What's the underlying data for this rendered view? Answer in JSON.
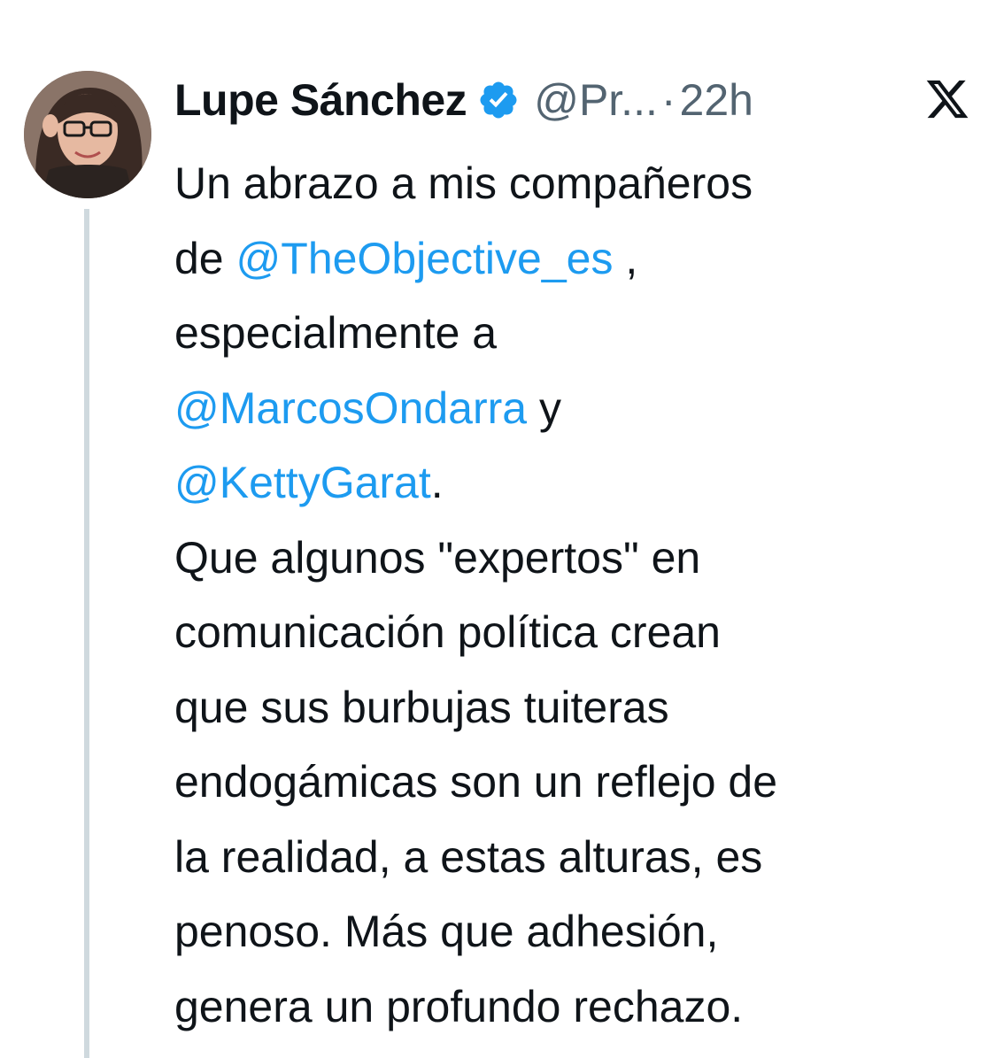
{
  "tweet": {
    "author_name": "Lupe Sánchez",
    "handle": "@Pr...",
    "separator": "·",
    "time": "22h",
    "verified_icon": "verified-badge-icon",
    "brand_icon": "x-logo-icon",
    "colors": {
      "mention": "#1d9bf0",
      "text": "#0f1419",
      "secondary": "#536471",
      "thread_line": "#cfd9de"
    },
    "lines": [
      {
        "text": "Un abrazo a mis compañeros"
      },
      {
        "pre": "de ",
        "mention": "@TheObjective_es",
        "post": " ,"
      },
      {
        "text": "especialmente a"
      },
      {
        "mention": "@MarcosOndarra",
        "post": " y"
      },
      {
        "mention": "@KettyGarat",
        "post": "."
      },
      {
        "text": "Que algunos \"expertos\" en"
      },
      {
        "text": "comunicación política crean"
      },
      {
        "text": "que sus burbujas tuiteras"
      },
      {
        "text": "endogámicas son un reflejo de"
      },
      {
        "text": "la realidad, a estas alturas, es"
      },
      {
        "text": "penoso. Más que adhesión,"
      },
      {
        "text": "genera un profundo rechazo."
      }
    ]
  }
}
